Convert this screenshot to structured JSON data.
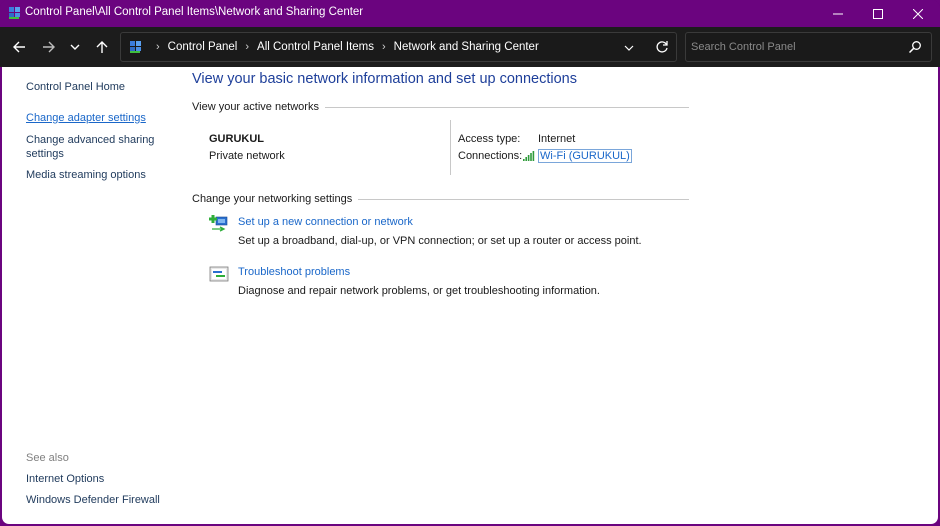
{
  "window": {
    "title": "Control Panel\\All Control Panel Items\\Network and Sharing Center",
    "controls": {
      "minimize": "minimize",
      "maximize": "maximize",
      "close": "close"
    },
    "accent_color": "#6b047f"
  },
  "navbar": {
    "breadcrumbs": [
      "Control Panel",
      "All Control Panel Items",
      "Network and Sharing Center"
    ],
    "search_placeholder": "Search Control Panel"
  },
  "sidebar": {
    "home": "Control Panel Home",
    "links": [
      "Change adapter settings",
      "Change advanced sharing settings",
      "Media streaming options"
    ],
    "see_also_label": "See also",
    "see_also": [
      "Internet Options",
      "Windows Defender Firewall"
    ]
  },
  "main": {
    "title": "View your basic network information and set up connections",
    "active_networks": {
      "header": "View your active networks",
      "network_name": "GURUKUL",
      "network_type": "Private network",
      "access_type_label": "Access type:",
      "access_type_value": "Internet",
      "connections_label": "Connections:",
      "connection_link": "Wi-Fi (GURUKUL)"
    },
    "networking_settings": {
      "header": "Change your networking settings",
      "tasks": [
        {
          "icon": "new-connection-icon",
          "link": "Set up a new connection or network",
          "description": "Set up a broadband, dial-up, or VPN connection; or set up a router or access point."
        },
        {
          "icon": "troubleshoot-icon",
          "link": "Troubleshoot problems",
          "description": "Diagnose and repair network problems, or get troubleshooting information."
        }
      ]
    }
  }
}
